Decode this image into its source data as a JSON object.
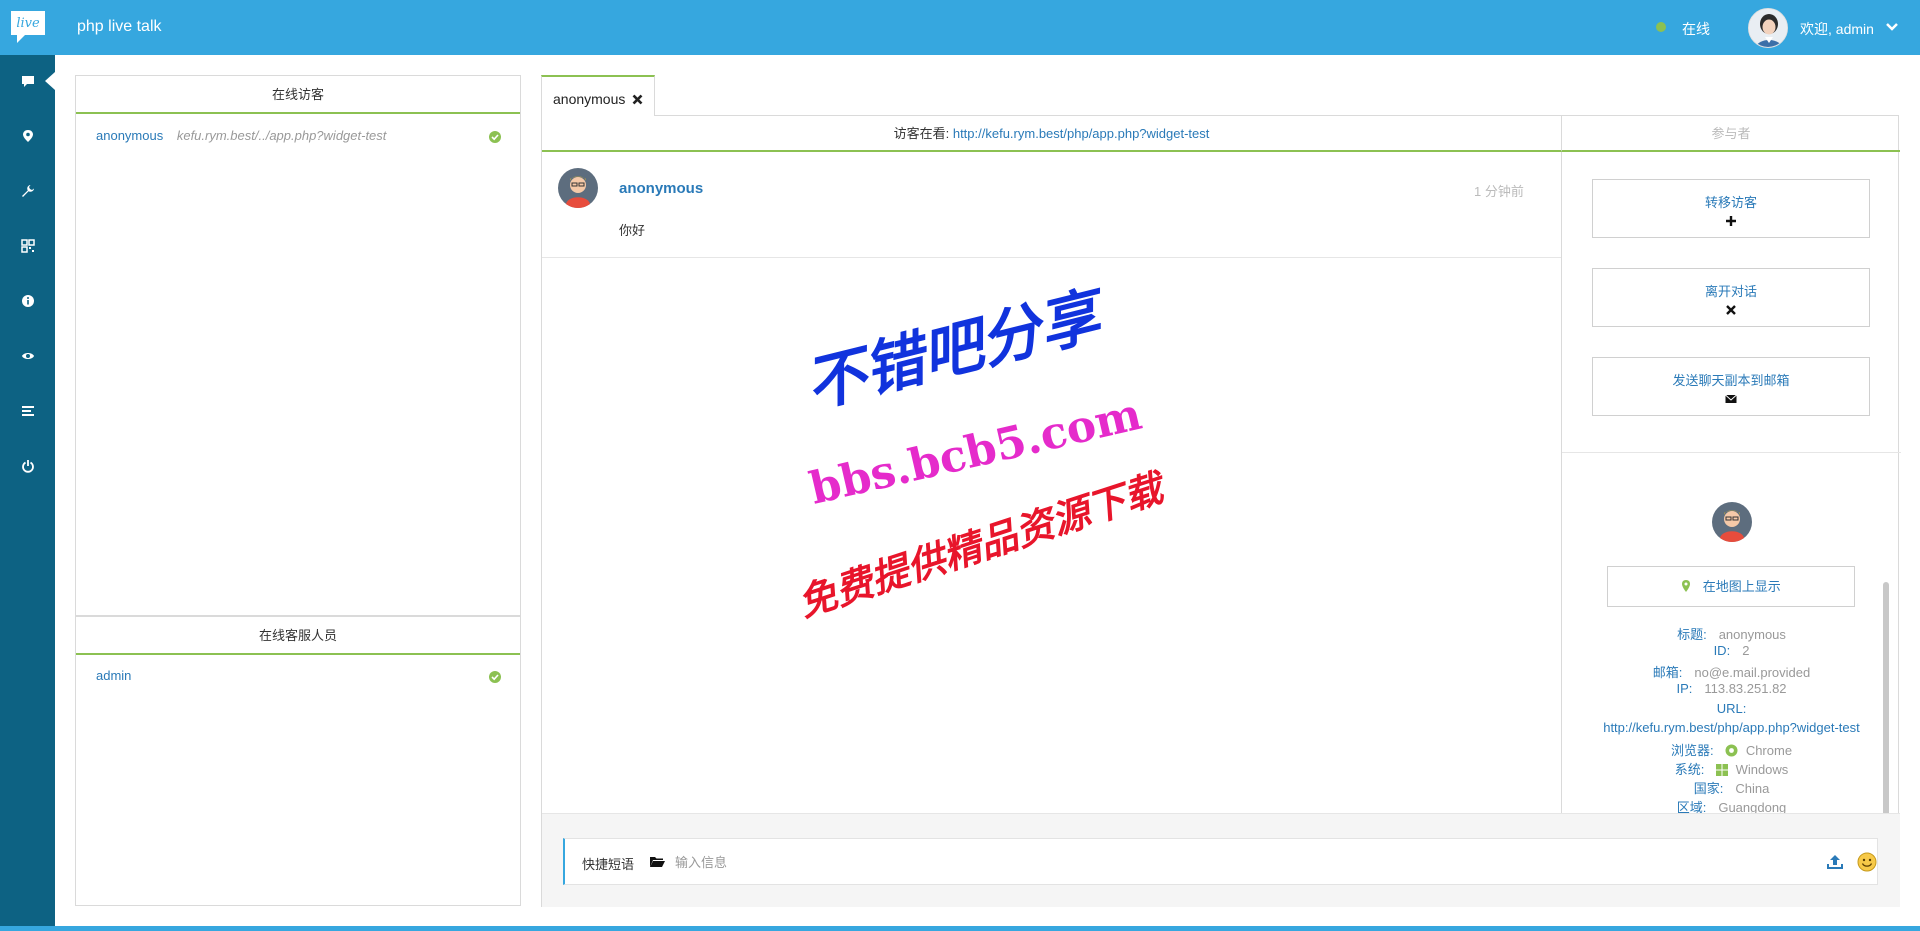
{
  "app": {
    "logo_text": "live",
    "title": "php live talk",
    "status": "在线",
    "status_color": "#8cc152",
    "welcome": "欢迎, admin",
    "accent": "#36a7df",
    "nav_color": "#0d6283"
  },
  "nav": [
    {
      "icon": "chat-icon"
    },
    {
      "icon": "map-marker-icon"
    },
    {
      "icon": "wrench-icon"
    },
    {
      "icon": "qrcode-icon"
    },
    {
      "icon": "info-icon"
    },
    {
      "icon": "eye-icon"
    },
    {
      "icon": "list-icon"
    },
    {
      "icon": "power-icon"
    }
  ],
  "visitors_panel": {
    "title": "在线访客",
    "items": [
      {
        "name": "anonymous",
        "url": "kefu.rym.best/../app.php?widget-test"
      }
    ]
  },
  "operators_panel": {
    "title": "在线客服人员",
    "items": [
      {
        "name": "admin"
      }
    ]
  },
  "chat": {
    "tab_label": "anonymous",
    "viewing_label": "访客在看:",
    "viewing_url": "http://kefu.rym.best/php/app.php?widget-test",
    "participants_label": "参与者",
    "messages": [
      {
        "author": "anonymous",
        "time": "1 分钟前",
        "text": "你好"
      }
    ]
  },
  "actions": [
    {
      "label": "转移访客",
      "icon": "plus-icon"
    },
    {
      "label": "离开对话",
      "icon": "close-icon"
    },
    {
      "label": "发送聊天副本到邮箱",
      "icon": "envelope-icon"
    }
  ],
  "visitor_info": {
    "map_button": "在地图上显示",
    "fields": [
      {
        "k": "标题:",
        "v": "anonymous"
      },
      {
        "k": "ID:",
        "v": "2"
      },
      {
        "k": "邮箱:",
        "v": "no@e.mail.provided"
      },
      {
        "k": "IP:",
        "v": "113.83.251.82"
      },
      {
        "k": "URL:",
        "v": ""
      },
      {
        "k": "",
        "v": "http://kefu.rym.best/php/app.php?widget-test"
      },
      {
        "k": "浏览器:",
        "v": "Chrome"
      },
      {
        "k": "系统:",
        "v": "Windows"
      },
      {
        "k": "国家:",
        "v": "China"
      },
      {
        "k": "区域:",
        "v": "Guangdong"
      }
    ]
  },
  "composer": {
    "quick_label": "快捷短语",
    "placeholder": "输入信息"
  },
  "watermark": {
    "line1": "不错吧分享",
    "line2": "bbs.bcb5.com",
    "line3": "免费提供精品资源下载"
  }
}
